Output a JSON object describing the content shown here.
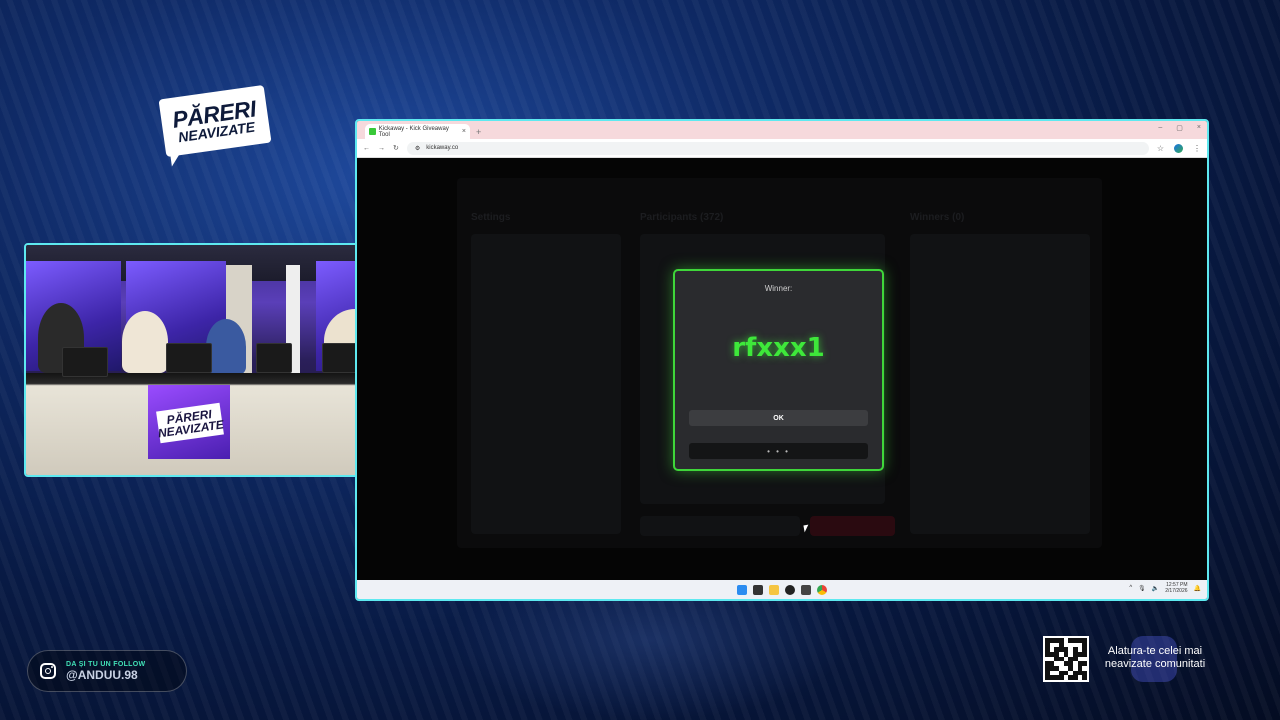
{
  "logo": {
    "line1": "PĂRERI",
    "line2": "NEAVIZATE"
  },
  "studio_logo": {
    "line1": "PĂRERI",
    "line2": "NEAVIZATE"
  },
  "browser": {
    "tab_title": "Kickaway - Kick Giveaway Tool",
    "tab_close": "×",
    "new_tab": "+",
    "window_controls": [
      "–",
      "▢",
      "×"
    ],
    "url": "kickaway.co",
    "nav": {
      "back": "←",
      "forward": "→",
      "reload": "↻"
    },
    "star": "☆",
    "menu": "⋮"
  },
  "background_app": {
    "settings_title": "Settings",
    "participants_title": "Participants (372)",
    "winners_title": "Winners (0)"
  },
  "modal": {
    "label": "Winner:",
    "winner": "rfxxx1",
    "ok_label": "OK",
    "more_label": "• • •"
  },
  "taskbar": {
    "time": "12:57 PM",
    "date": "2/17/2026",
    "tray": "^"
  },
  "instagram": {
    "subtitle": "DA ȘI TU UN FOLLOW",
    "handle": "@ANDUU.98"
  },
  "community": {
    "text": "Alatura-te celei mai neavizate comunitati"
  },
  "colors": {
    "accent_cyan": "#5ee9f0",
    "winner_green": "#3ee83a",
    "instagram_green": "#41e0b6"
  }
}
